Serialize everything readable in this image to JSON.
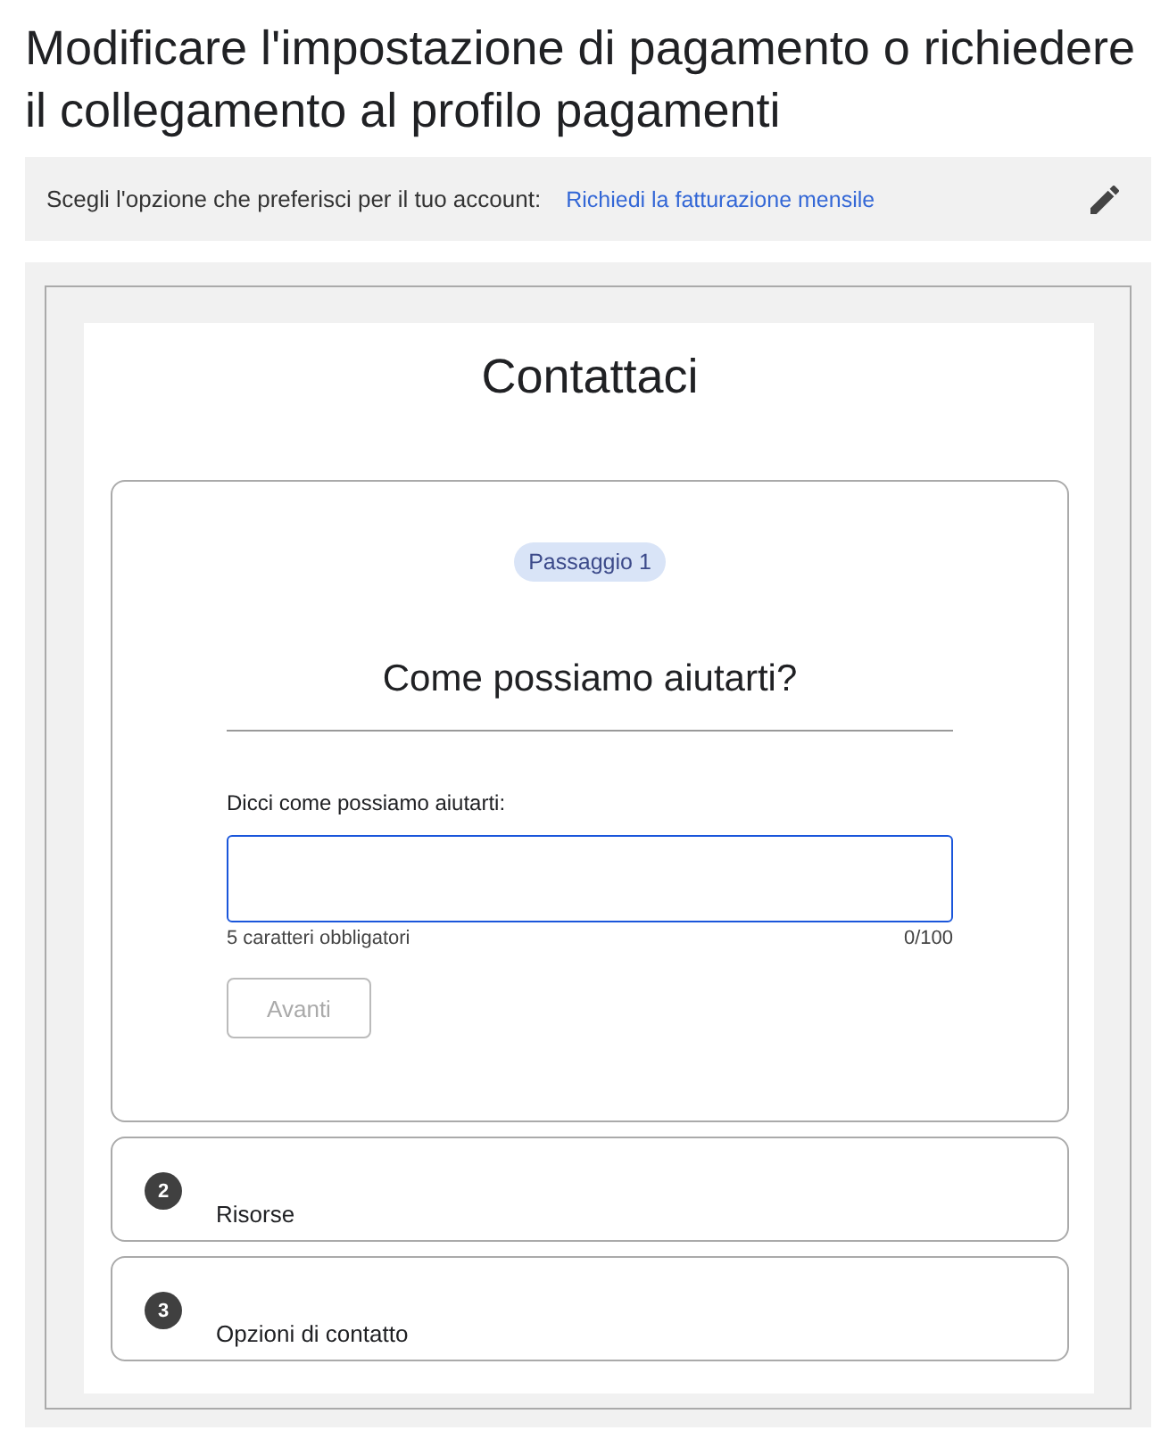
{
  "page_title": "Modificare l'impostazione di pagamento o richiedere il collegamento al profilo pagamenti",
  "option_bar": {
    "label": "Scegli l'opzione che preferisci per il tuo account:",
    "link": "Richiedi la fatturazione mensile"
  },
  "contact": {
    "title": "Contattaci",
    "current_step": {
      "badge": "Passaggio 1",
      "heading": "Come possiamo aiutarti?",
      "field_label": "Dicci come possiamo aiutarti:",
      "hint": "5 caratteri obbligatori",
      "counter": "0/100",
      "button": {
        "label": "Avanti",
        "disabled": true
      }
    },
    "other_steps": [
      {
        "number": "2",
        "title": "Risorse"
      },
      {
        "number": "3",
        "title": "Opzioni di contatto"
      }
    ]
  }
}
